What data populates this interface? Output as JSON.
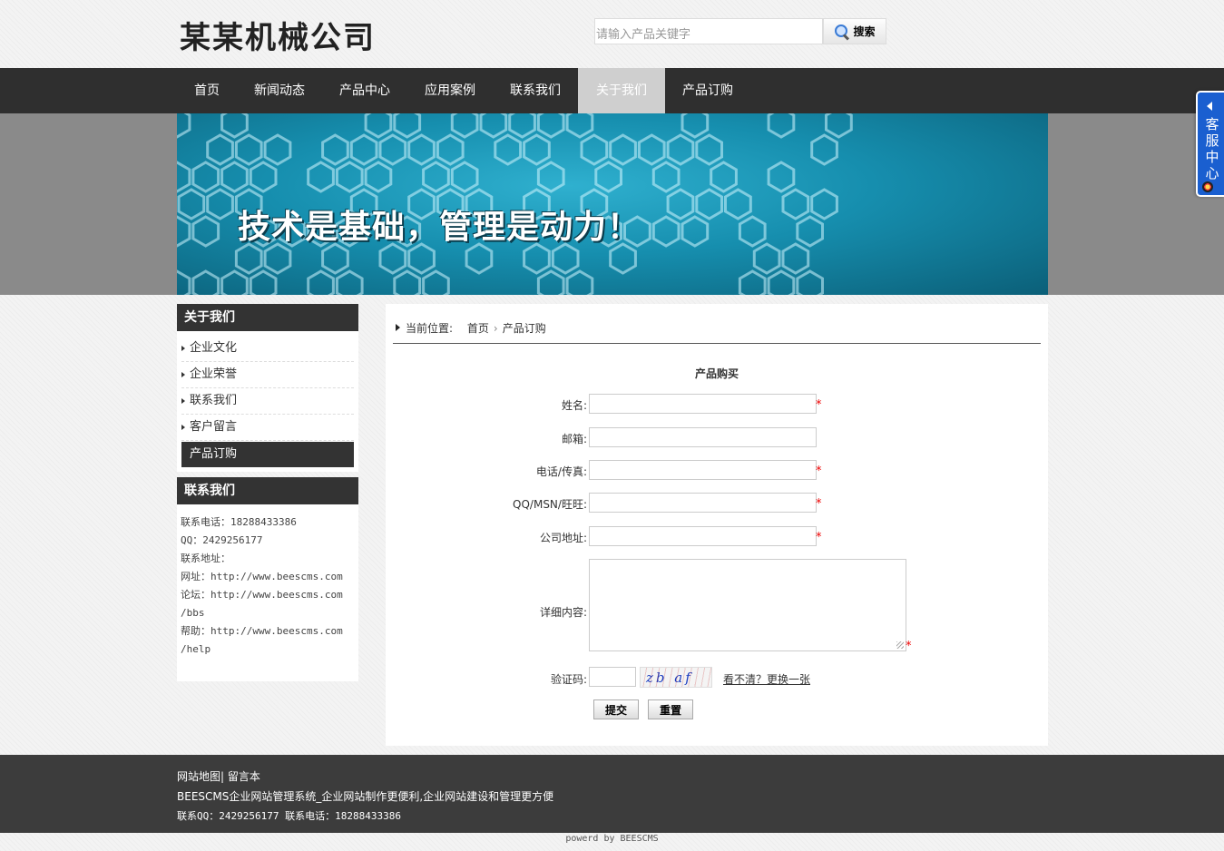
{
  "header": {
    "logo": "某某机械公司",
    "search_placeholder": "请输入产品关键字",
    "search_button": "搜索"
  },
  "nav": {
    "items": [
      "首页",
      "新闻动态",
      "产品中心",
      "应用案例",
      "联系我们",
      "关于我们",
      "产品订购"
    ],
    "active": "关于我们"
  },
  "banner": {
    "slogan": "技术是基础，管理是动力！"
  },
  "sidebar": {
    "about_title": "关于我们",
    "about_items": [
      "企业文化",
      "企业荣誉",
      "联系我们",
      "客户留言",
      "产品订购"
    ],
    "contact_title": "联系我们",
    "contact_lines": [
      "联系电话：18288433386",
      "QQ：2429256177",
      "联系地址：",
      "网址：http://www.beescms.com",
      "论坛：http://www.beescms.com",
      "/bbs",
      "帮助：http://www.beescms.com",
      "/help"
    ]
  },
  "breadcrumb": {
    "label": "当前位置:",
    "home": "首页",
    "current": "产品订购"
  },
  "form": {
    "title": "产品购买",
    "name_label": "姓名:",
    "email_label": "邮箱:",
    "phone_label": "电话/传真:",
    "im_label": "QQ/MSN/旺旺:",
    "address_label": "公司地址:",
    "detail_label": "详细内容:",
    "captcha_label": "验证码:",
    "captcha_text": "zb af",
    "refresh_link": "看不清？更换一张",
    "submit": "提交",
    "reset": "重置",
    "required_mark": "*"
  },
  "footer": {
    "sitemap": "网站地图",
    "separator": "|",
    "guestbook": "留言本",
    "slogan": "BEESCMS企业网站管理系统_企业网站制作更便利,企业网站建设和管理更方便",
    "contact": "联系QQ：2429256177 联系电话：18288433386",
    "powered": "powerd by BEESCMS"
  },
  "service": {
    "label": "客服中心"
  },
  "colors": {
    "nav_bg": "#2f2f2f",
    "active_nav": "#cfcfcf",
    "footer_bg": "#3c3c3c",
    "service_blue": "#1a5fd0",
    "required": "#ee0000"
  }
}
